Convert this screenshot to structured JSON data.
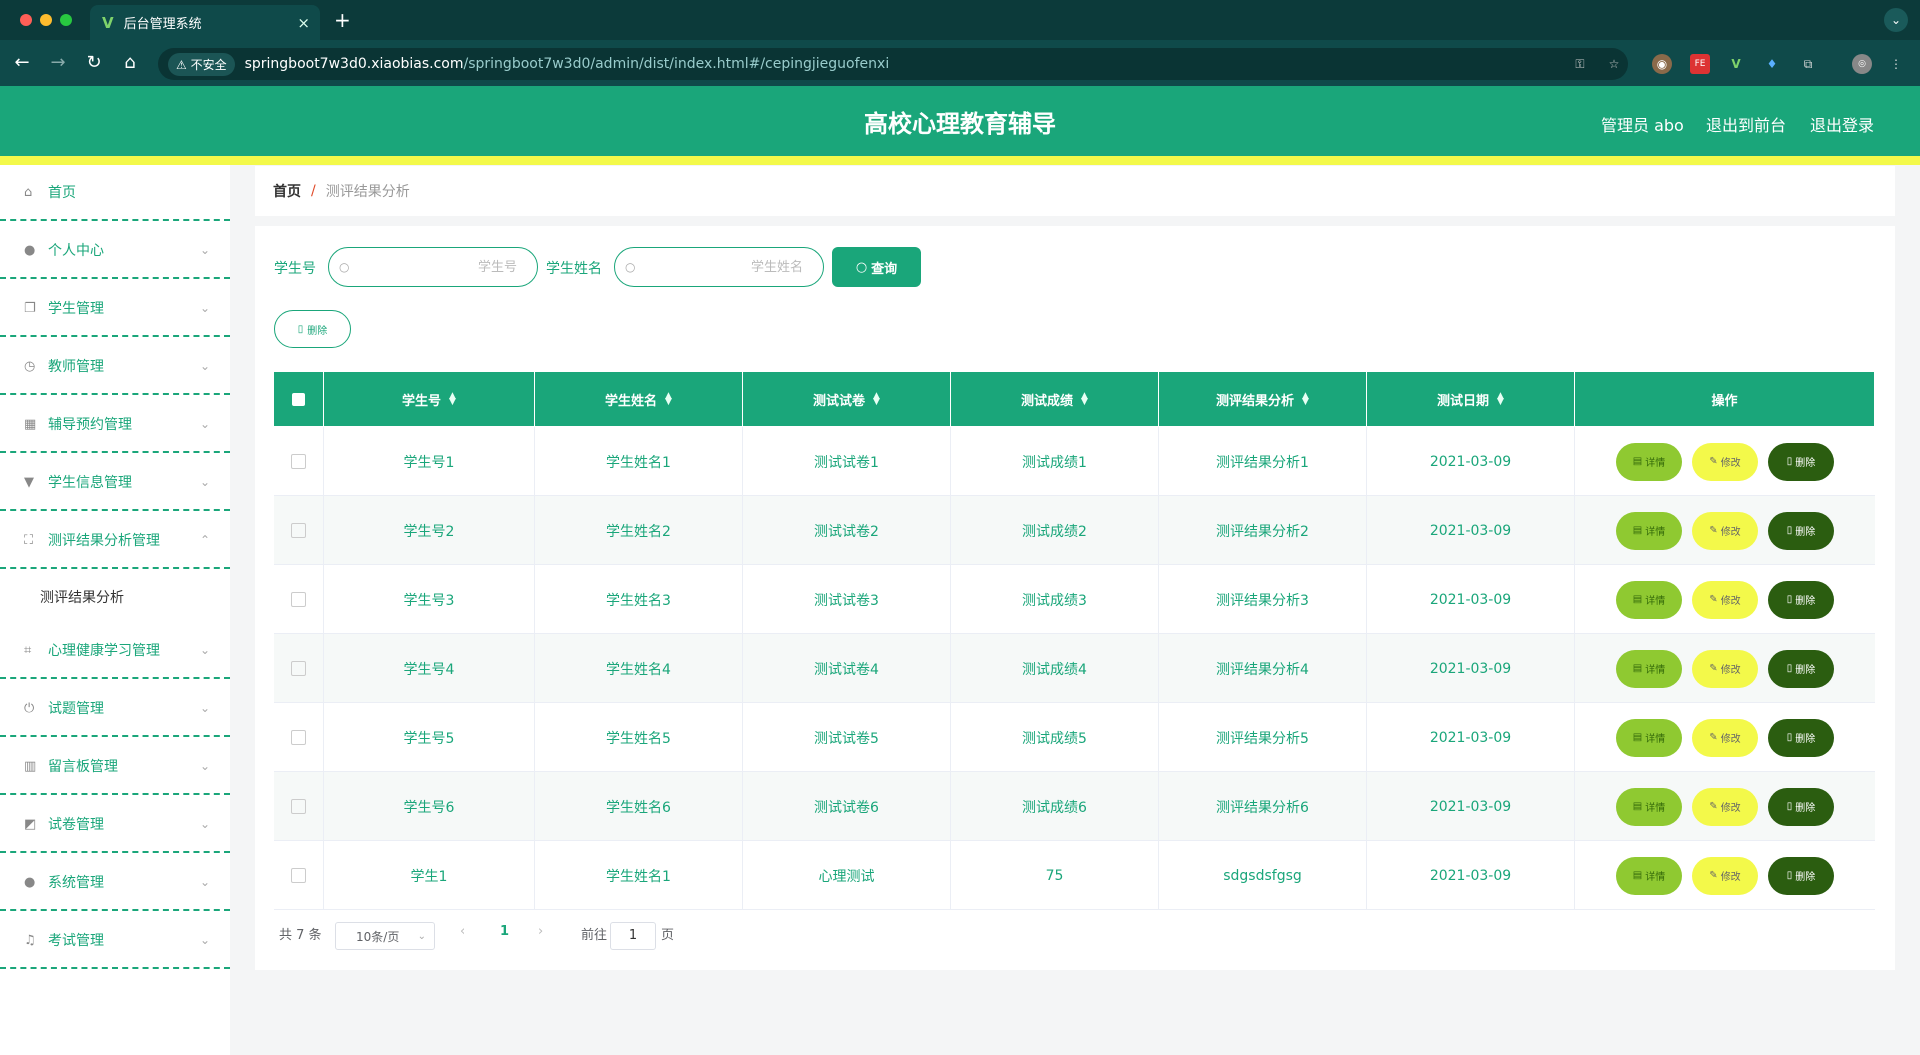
{
  "browser": {
    "tab_title": "后台管理系统",
    "tab_close": "×",
    "new_tab": "+",
    "menu_glyph": "⌄",
    "insecure_label": "不安全",
    "url_host": "springboot7w3d0.xiaobias.com",
    "url_path": "/springboot7w3d0/admin/dist/index.html#/cepingjieguofenxi"
  },
  "header": {
    "title": "高校心理教育辅导",
    "user": "管理员 abo",
    "to_front": "退出到前台",
    "logout": "退出登录"
  },
  "sidebar": {
    "items": [
      {
        "label": "首页",
        "icon": "home-icon",
        "glyph": "⌂",
        "expandable": false
      },
      {
        "label": "个人中心",
        "icon": "user-icon",
        "glyph": "●",
        "expandable": true
      },
      {
        "label": "学生管理",
        "icon": "copy-icon",
        "glyph": "❐",
        "expandable": true
      },
      {
        "label": "教师管理",
        "icon": "clock-icon",
        "glyph": "◷",
        "expandable": true
      },
      {
        "label": "辅导预约管理",
        "icon": "grid-icon",
        "glyph": "▦",
        "expandable": true
      },
      {
        "label": "学生信息管理",
        "icon": "brush-icon",
        "glyph": "▼",
        "expandable": true
      },
      {
        "label": "测评结果分析管理",
        "icon": "fullscreen-icon",
        "glyph": "⛶",
        "expandable": true,
        "open": true
      },
      {
        "label": "心理健康学习管理",
        "icon": "crop-icon",
        "glyph": "⌗",
        "expandable": true
      },
      {
        "label": "试题管理",
        "icon": "power-icon",
        "glyph": "⏻",
        "expandable": true
      },
      {
        "label": "留言板管理",
        "icon": "books-icon",
        "glyph": "▥",
        "expandable": true
      },
      {
        "label": "试卷管理",
        "icon": "chart-icon",
        "glyph": "◩",
        "expandable": true
      },
      {
        "label": "系统管理",
        "icon": "user-icon",
        "glyph": "●",
        "expandable": true
      },
      {
        "label": "考试管理",
        "icon": "bell-off-icon",
        "glyph": "♫",
        "expandable": true
      }
    ],
    "submenu": "测评结果分析"
  },
  "breadcrumb": {
    "home": "首页",
    "separator": "/",
    "current": "测评结果分析"
  },
  "search": {
    "field1_label": "学生号",
    "field1_placeholder": "学生号",
    "field2_label": "学生姓名",
    "field2_placeholder": "学生姓名",
    "query_label": "查询",
    "delete_label": "删除"
  },
  "table": {
    "columns": [
      "学生号",
      "学生姓名",
      "测试试卷",
      "测试成绩",
      "测评结果分析",
      "测试日期",
      "操作"
    ],
    "rows": [
      [
        "学生号1",
        "学生姓名1",
        "测试试卷1",
        "测试成绩1",
        "测评结果分析1",
        "2021-03-09"
      ],
      [
        "学生号2",
        "学生姓名2",
        "测试试卷2",
        "测试成绩2",
        "测评结果分析2",
        "2021-03-09"
      ],
      [
        "学生号3",
        "学生姓名3",
        "测试试卷3",
        "测试成绩3",
        "测评结果分析3",
        "2021-03-09"
      ],
      [
        "学生号4",
        "学生姓名4",
        "测试试卷4",
        "测试成绩4",
        "测评结果分析4",
        "2021-03-09"
      ],
      [
        "学生号5",
        "学生姓名5",
        "测试试卷5",
        "测试成绩5",
        "测评结果分析5",
        "2021-03-09"
      ],
      [
        "学生号6",
        "学生姓名6",
        "测试试卷6",
        "测试成绩6",
        "测评结果分析6",
        "2021-03-09"
      ],
      [
        "学生1",
        "学生姓名1",
        "心理测试",
        "75",
        "sdgsdsfgsg",
        "2021-03-09"
      ]
    ],
    "actions": {
      "detail": "详情",
      "edit": "修改",
      "delete": "删除"
    }
  },
  "pagination": {
    "total": "共 7 条",
    "page_size": "10条/页",
    "current_page": "1",
    "goto_prefix": "前往",
    "goto_value": "1",
    "goto_suffix": "页"
  },
  "colors": {
    "primary": "#1aa67a",
    "accent_yellow": "#f3f94a",
    "detail_green": "#8fc931",
    "delete_dark": "#2b5d10",
    "chrome_dark": "#0f4a4a"
  }
}
